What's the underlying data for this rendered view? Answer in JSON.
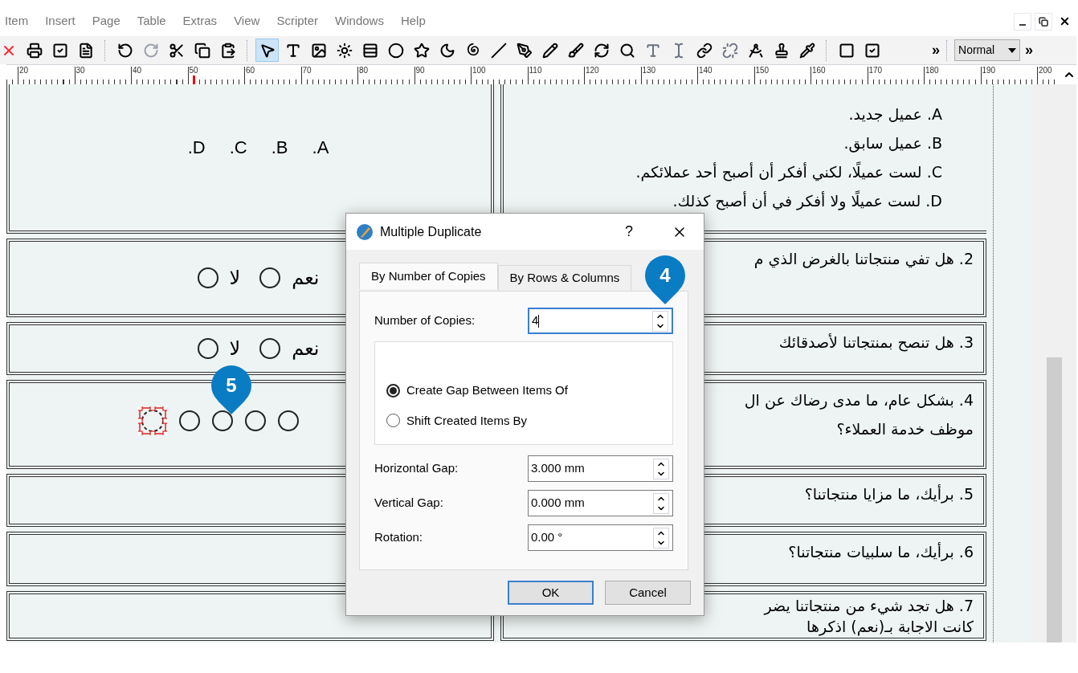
{
  "menu": [
    {
      "label": "Item"
    },
    {
      "label": "Insert"
    },
    {
      "label": "Page"
    },
    {
      "label": "Table"
    },
    {
      "label": "Extras"
    },
    {
      "label": "View"
    },
    {
      "label": "Scripter"
    },
    {
      "label": "Windows"
    },
    {
      "label": "Help"
    }
  ],
  "toolbar": {
    "tools": [
      {
        "kind": "close",
        "selected": false
      },
      {
        "kind": "print",
        "selected": false
      },
      {
        "kind": "check",
        "selected": false
      },
      {
        "kind": "pdf",
        "selected": false
      },
      {
        "kind": "sep"
      },
      {
        "kind": "undo",
        "selected": false
      },
      {
        "kind": "redo",
        "selected": false
      },
      {
        "kind": "cut",
        "selected": false
      },
      {
        "kind": "copy",
        "selected": false
      },
      {
        "kind": "paste",
        "selected": false
      },
      {
        "kind": "sep"
      },
      {
        "kind": "select",
        "selected": true
      },
      {
        "kind": "text",
        "selected": false
      },
      {
        "kind": "image",
        "selected": false
      },
      {
        "kind": "render",
        "selected": false
      },
      {
        "kind": "table",
        "selected": false
      },
      {
        "kind": "shape",
        "selected": false
      },
      {
        "kind": "star",
        "selected": false
      },
      {
        "kind": "arc",
        "selected": false
      },
      {
        "kind": "spiral",
        "selected": false
      },
      {
        "kind": "line",
        "selected": false
      },
      {
        "kind": "bezier",
        "selected": false
      },
      {
        "kind": "pencil",
        "selected": false
      },
      {
        "kind": "brush",
        "selected": false
      },
      {
        "kind": "rotate",
        "selected": false
      },
      {
        "kind": "zoom",
        "selected": false
      },
      {
        "kind": "textedit",
        "selected": false
      },
      {
        "kind": "story",
        "selected": false
      },
      {
        "kind": "link",
        "selected": false
      },
      {
        "kind": "unlink",
        "selected": false
      },
      {
        "kind": "measure",
        "selected": false
      },
      {
        "kind": "stamp",
        "selected": false
      },
      {
        "kind": "eyedropper",
        "selected": false
      },
      {
        "kind": "sep"
      },
      {
        "kind": "frame",
        "selected": false
      },
      {
        "kind": "check",
        "selected": false
      }
    ],
    "overflow": "»",
    "mode": "Normal",
    "overflow_end": "»"
  },
  "ruler": {
    "ticks": [
      "20",
      "30",
      "40",
      "50",
      "60",
      "70",
      "80",
      "90",
      "100",
      "110",
      "120",
      "130",
      "140",
      "150",
      "160",
      "170",
      "180",
      "190",
      "200"
    ]
  },
  "document": {
    "rows": [
      {
        "left": {
          "kind": "letters",
          "options": [
            {
              "label": "D."
            },
            {
              "label": "C."
            },
            {
              "label": "B."
            },
            {
              "label": "A."
            }
          ]
        },
        "right": {
          "lines": [
            "A. عميل جديد.",
            "B. عميل سابق.",
            "C. لست عميلًا، لكني أفكر أن أصبح أحد عملائكم.",
            "D. لست عميلًا ولا أفكر في أن أصبح كذلك."
          ]
        }
      },
      {
        "left": {
          "kind": "yesno",
          "options": [
            {
              "label": "نعم"
            },
            {
              "label": "لا"
            }
          ]
        },
        "right": {
          "lines": [
            "2. هل تفي منتجاتنا بالغرض الذي م"
          ]
        }
      },
      {
        "left": {
          "kind": "yesno",
          "options": [
            {
              "label": "نعم"
            },
            {
              "label": "لا"
            }
          ]
        },
        "right": {
          "lines": [
            "3. هل تنصح بمنتجاتنا لأصدقائك"
          ]
        }
      },
      {
        "left": {
          "kind": "scale"
        },
        "right": {
          "lines": [
            "4. بشكل عام، ما مدى رضاك عن ال",
            "موظف خدمة العملاء؟"
          ]
        }
      },
      {
        "left": {
          "kind": "empty"
        },
        "right": {
          "lines": [
            "5. برأيك، ما مزايا منتجاتنا؟"
          ]
        }
      },
      {
        "left": {
          "kind": "empty"
        },
        "right": {
          "lines": [
            "6. برأيك، ما سلبيات منتجاتنا؟"
          ]
        }
      },
      {
        "left": {
          "kind": "empty"
        },
        "right": {
          "lines": [
            "7. هل تجد شيء من منتجاتنا يضر",
            "كانت الاجابة بـ(نعم) اذكرها"
          ]
        }
      }
    ]
  },
  "dialog": {
    "title": "Multiple Duplicate",
    "help": "?",
    "tabs": [
      {
        "label": "By Number of Copies",
        "selected": true
      },
      {
        "label": "By Rows & Columns",
        "selected": false
      }
    ],
    "copies": {
      "label": "Number of Copies:",
      "value": "4",
      "focused": true
    },
    "radios": [
      {
        "label": "Create Gap Between Items Of",
        "selected": true
      },
      {
        "label": "Shift Created Items By",
        "selected": false
      }
    ],
    "fields": [
      {
        "label": "Horizontal Gap:",
        "value": "3.000 mm",
        "focused": false
      },
      {
        "label": "Vertical Gap:",
        "value": "0.000 mm",
        "focused": false
      },
      {
        "label": "Rotation:",
        "value": "0.00 °",
        "focused": false
      }
    ],
    "buttons": [
      {
        "label": "OK",
        "default": true
      },
      {
        "label": "Cancel",
        "default": false
      }
    ]
  },
  "callouts": [
    {
      "label": "4"
    },
    {
      "label": "5"
    }
  ]
}
